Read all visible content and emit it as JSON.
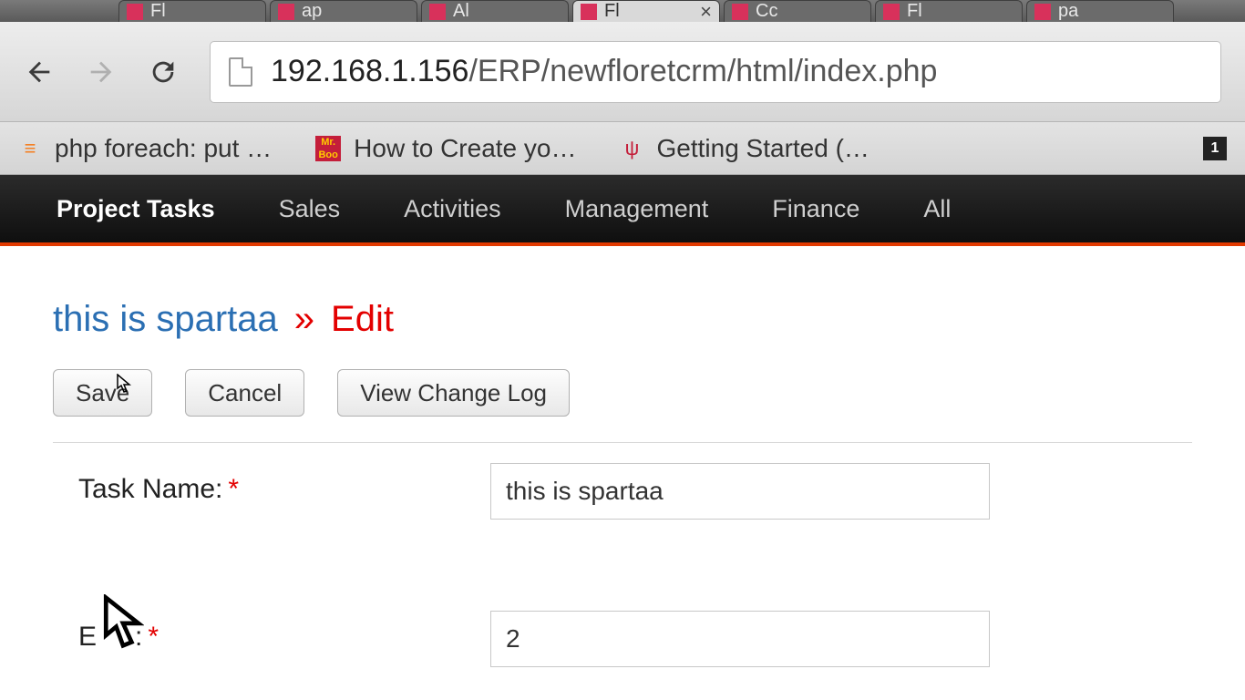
{
  "browser": {
    "tabs": [
      {
        "label": "Fl"
      },
      {
        "label": "ap"
      },
      {
        "label": "Al"
      },
      {
        "label": "Fl",
        "active": true
      },
      {
        "label": "Cc"
      },
      {
        "label": "Fl"
      },
      {
        "label": "pa"
      }
    ],
    "url_host": "192.168.1.156",
    "url_path": "/ERP/newfloretcrm/html/index.php",
    "bookmarks": [
      {
        "label": "php foreach: put …"
      },
      {
        "label": "How to Create yo…"
      },
      {
        "label": "Getting Started (…"
      }
    ]
  },
  "nav": {
    "items": [
      {
        "label": "Project Tasks",
        "active": true
      },
      {
        "label": "Sales"
      },
      {
        "label": "Activities"
      },
      {
        "label": "Management"
      },
      {
        "label": "Finance"
      },
      {
        "label": "All"
      }
    ]
  },
  "page": {
    "breadcrumb_link": "this is spartaa",
    "breadcrumb_sep": "»",
    "breadcrumb_current": "Edit",
    "buttons": {
      "save": "Save",
      "cancel": "Cancel",
      "changelog": "View Change Log"
    },
    "form": {
      "task_name_label": "Task Name:",
      "task_name_value": "this is spartaa",
      "et_label_prefix": "E",
      "et_label_suffix": ":",
      "et_value": "2",
      "required_marker": "*"
    }
  }
}
